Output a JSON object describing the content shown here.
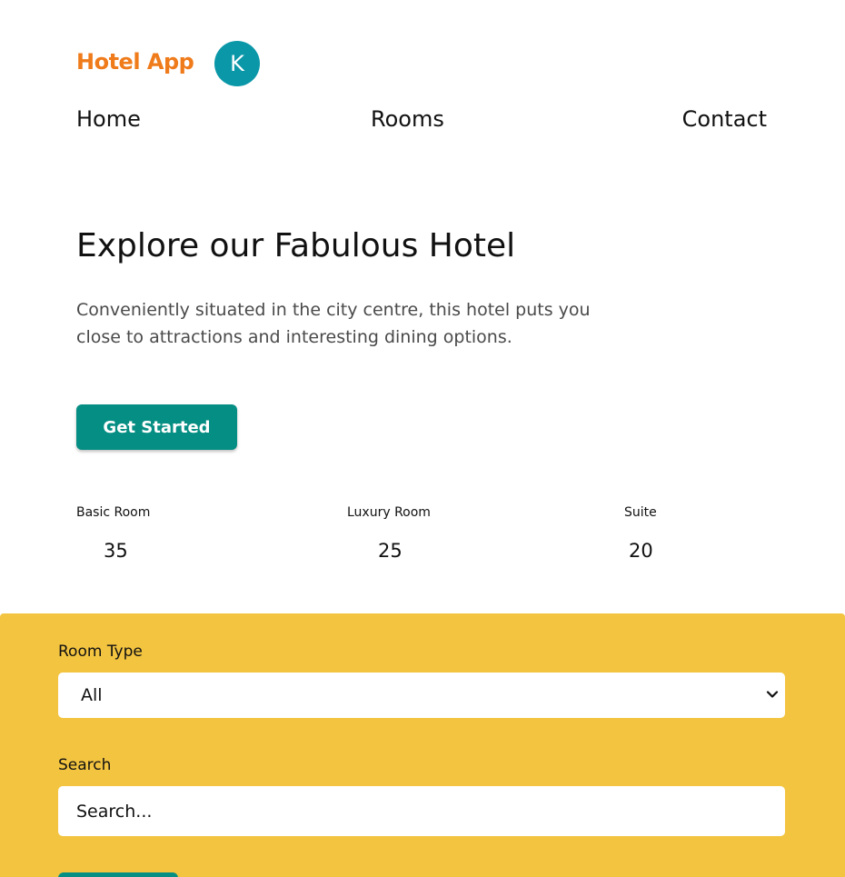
{
  "header": {
    "brand": "Hotel App",
    "avatar_initial": "K"
  },
  "nav": {
    "items": [
      {
        "label": "Home"
      },
      {
        "label": "Rooms"
      },
      {
        "label": "Contact"
      }
    ]
  },
  "hero": {
    "title": "Explore our Fabulous Hotel",
    "description": "Conveniently situated in the city centre, this hotel puts you close to attractions and interesting dining options.",
    "cta_label": "Get Started"
  },
  "stats": [
    {
      "label": "Basic Room",
      "value": "35"
    },
    {
      "label": "Luxury Room",
      "value": "25"
    },
    {
      "label": "Suite",
      "value": "20"
    }
  ],
  "filter": {
    "room_type_label": "Room Type",
    "room_type_selected": "All",
    "search_label": "Search",
    "search_placeholder": "Search...",
    "search_value": ""
  },
  "icons": {
    "select_chevron": "chevron-down-icon"
  },
  "colors": {
    "brand": "#ef7b1b",
    "avatar": "#0a97a8",
    "primary_button": "#058e83",
    "filter_panel": "#f2c440"
  }
}
